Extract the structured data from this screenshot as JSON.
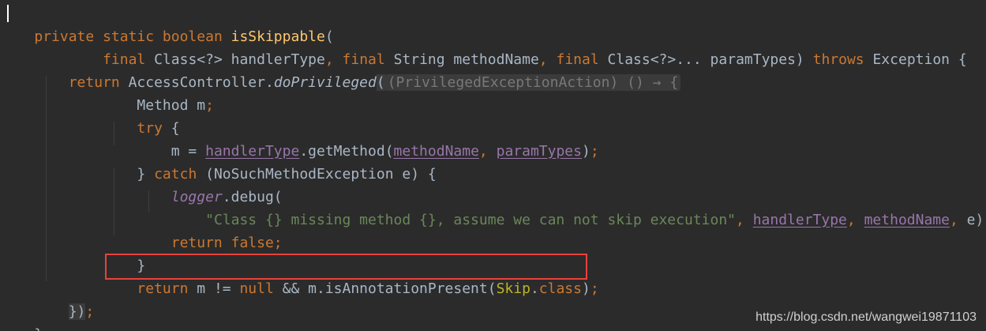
{
  "code": {
    "l1": {
      "kw_private": "private ",
      "kw_static": "static ",
      "kw_boolean": "boolean ",
      "method_name": "isSkippable",
      "paren": "("
    },
    "l2": {
      "indent": "        ",
      "kw_final1": "final ",
      "t1": "Class<?> handlerType",
      "c1": ", ",
      "kw_final2": "final ",
      "t2": "String methodName",
      "c2": ", ",
      "kw_final3": "final ",
      "t3": "Class<?>... paramTypes) ",
      "kw_throws": "throws ",
      "t4": "Exception {"
    },
    "l3": {
      "indent": "    ",
      "kw_return": "return ",
      "t1": "AccessController.",
      "method": "doPrivileged",
      "paren": "(",
      "hint": "(PrivilegedExceptionAction) () → {"
    },
    "l4": {
      "indent": "            ",
      "t1": "Method m",
      "semi": ";"
    },
    "l5": {
      "indent": "            ",
      "kw_try": "try ",
      "t1": "{"
    },
    "l6": {
      "indent": "                ",
      "t1": "m = ",
      "f1": "handlerType",
      "t2": ".getMethod(",
      "f2": "methodName",
      "c1": ", ",
      "f3": "paramTypes",
      "t3": ")",
      "semi": ";"
    },
    "l7": {
      "indent": "            ",
      "t1": "} ",
      "kw_catch": "catch ",
      "t2": "(NoSuchMethodException e) {"
    },
    "l8": {
      "indent": "                ",
      "logger": "logger",
      "t1": ".debug("
    },
    "l9": {
      "indent": "                    ",
      "str": "\"Class {} missing method {}, assume we can not skip execution\"",
      "c1": ", ",
      "f1": "handlerType",
      "c2": ", ",
      "f2": "methodName",
      "c3": ", ",
      "t1": "e)",
      "semi": ";"
    },
    "l10": {
      "indent": "                ",
      "kw_return": "return ",
      "kw_false": "false",
      "semi": ";"
    },
    "l11": {
      "indent": "            ",
      "t1": "}"
    },
    "l12": {
      "indent": "            ",
      "kw_return": "return ",
      "t1": "m != ",
      "kw_null": "null ",
      "t2": "&& m.isAnnotationPresent(",
      "ann": "Skip",
      "t3": ".",
      "kw_class": "class",
      "t4": ")",
      "semi": ";"
    },
    "l13": {
      "indent": "    ",
      "t1": "})",
      "semi": ";"
    },
    "l14": {
      "t1": "}"
    }
  },
  "watermark": "https://blog.csdn.net/wangwei19871103",
  "colors": {
    "background": "#2b2b2b",
    "keyword": "#cc7832",
    "method": "#ffc66d",
    "field": "#9876aa",
    "string": "#6a8759",
    "text": "#a9b7c6",
    "annotation_box": "#e8423b"
  }
}
